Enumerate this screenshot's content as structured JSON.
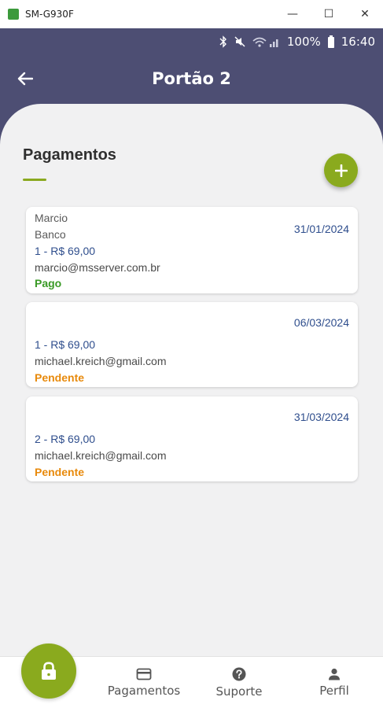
{
  "window": {
    "title": "SM-G930F",
    "minimize_glyph": "—",
    "maximize_glyph": "☐",
    "close_glyph": "✕"
  },
  "status_bar": {
    "battery": "100%",
    "time": "16:40"
  },
  "header": {
    "title": "Portão 2"
  },
  "section": {
    "title": "Pagamentos"
  },
  "payments": [
    {
      "name": "Marcio",
      "method": "Banco",
      "amount": "1 - R$ 69,00",
      "email": "marcio@msserver.com.br",
      "status": "Pago",
      "date": "31/01/2024"
    },
    {
      "amount": "1 - R$ 69,00",
      "email": "michael.kreich@gmail.com",
      "status": "Pendente",
      "date": "06/03/2024"
    },
    {
      "amount": "2 - R$ 69,00",
      "email": "michael.kreich@gmail.com",
      "status": "Pendente",
      "date": "31/03/2024"
    }
  ],
  "bottom_nav": {
    "items": [
      {
        "label": "Pagamentos",
        "icon": "card-icon"
      },
      {
        "label": "Suporte",
        "icon": "help-icon"
      },
      {
        "label": "Perfil",
        "icon": "person-icon"
      }
    ]
  },
  "colors": {
    "header": "#4d4e73",
    "accent": "#8aaa1e",
    "paid": "#3a9a26",
    "pending": "#e88a0c",
    "link_blue": "#2f4e8d"
  }
}
